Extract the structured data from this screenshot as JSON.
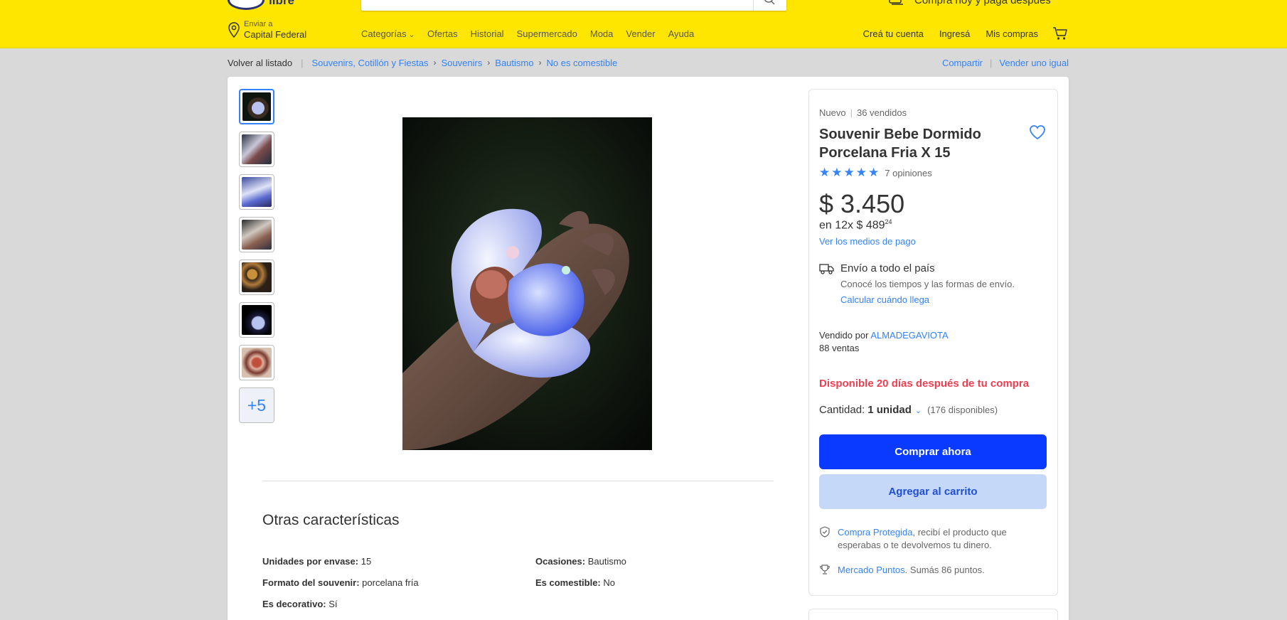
{
  "header": {
    "logo_text": "libre",
    "promo_text": "Comprá hoy y pagá después",
    "location_label": "Enviar a",
    "location_value": "Capital Federal",
    "nav": [
      "Categorías",
      "Ofertas",
      "Historial",
      "Supermercado",
      "Moda",
      "Vender",
      "Ayuda"
    ],
    "user_links": [
      "Creá tu cuenta",
      "Ingresá",
      "Mis compras"
    ]
  },
  "breadcrumb": {
    "back": "Volver al listado",
    "items": [
      "Souvenirs, Cotillón y Fiestas",
      "Souvenirs",
      "Bautismo",
      "No es comestible"
    ]
  },
  "actions": {
    "share": "Compartir",
    "sell_same": "Vender uno igual"
  },
  "gallery": {
    "more_label": "+5"
  },
  "product": {
    "condition": "Nuevo",
    "sold": "36 vendidos",
    "title": "Souvenir Bebe Dormido Porcelana Fria X 15",
    "rating": 5,
    "reviews": "7 opiniones",
    "price": "$ 3.450",
    "installments": "en 12x $ 489",
    "installments_cents": "24",
    "payment_link": "Ver los medios de pago",
    "shipping_title": "Envío a todo el país",
    "shipping_sub": "Conocé los tiempos y las formas de envío.",
    "shipping_link": "Calcular cuándo llega",
    "seller_prefix": "Vendido por",
    "seller_name": "ALMADEGAVIOTA",
    "seller_sales": "88 ventas",
    "availability": "Disponible 20 días después de tu compra",
    "quantity_label": "Cantidad:",
    "quantity_value": "1 unidad",
    "stock": "(176 disponibles)",
    "buy_now": "Comprar ahora",
    "add_cart": "Agregar al carrito",
    "protection_link": "Compra Protegida",
    "protection_text": ", recibí el producto que esperabas o te devolvemos tu dinero.",
    "points_link": "Mercado Puntos",
    "points_text": ". Sumás 86 puntos."
  },
  "specs": {
    "title": "Otras características",
    "items": [
      {
        "label": "Unidades por envase:",
        "value": "15"
      },
      {
        "label": "Ocasiones:",
        "value": "Bautismo"
      },
      {
        "label": "Formato del souvenir:",
        "value": "porcelana fría"
      },
      {
        "label": "Es comestible:",
        "value": "No"
      },
      {
        "label": "Es decorativo:",
        "value": "Sí"
      }
    ]
  },
  "colors": {
    "header_bg": "#fee600",
    "link": "#3483fa",
    "primary_button": "#0a3aff",
    "availability": "#f23d4f"
  }
}
